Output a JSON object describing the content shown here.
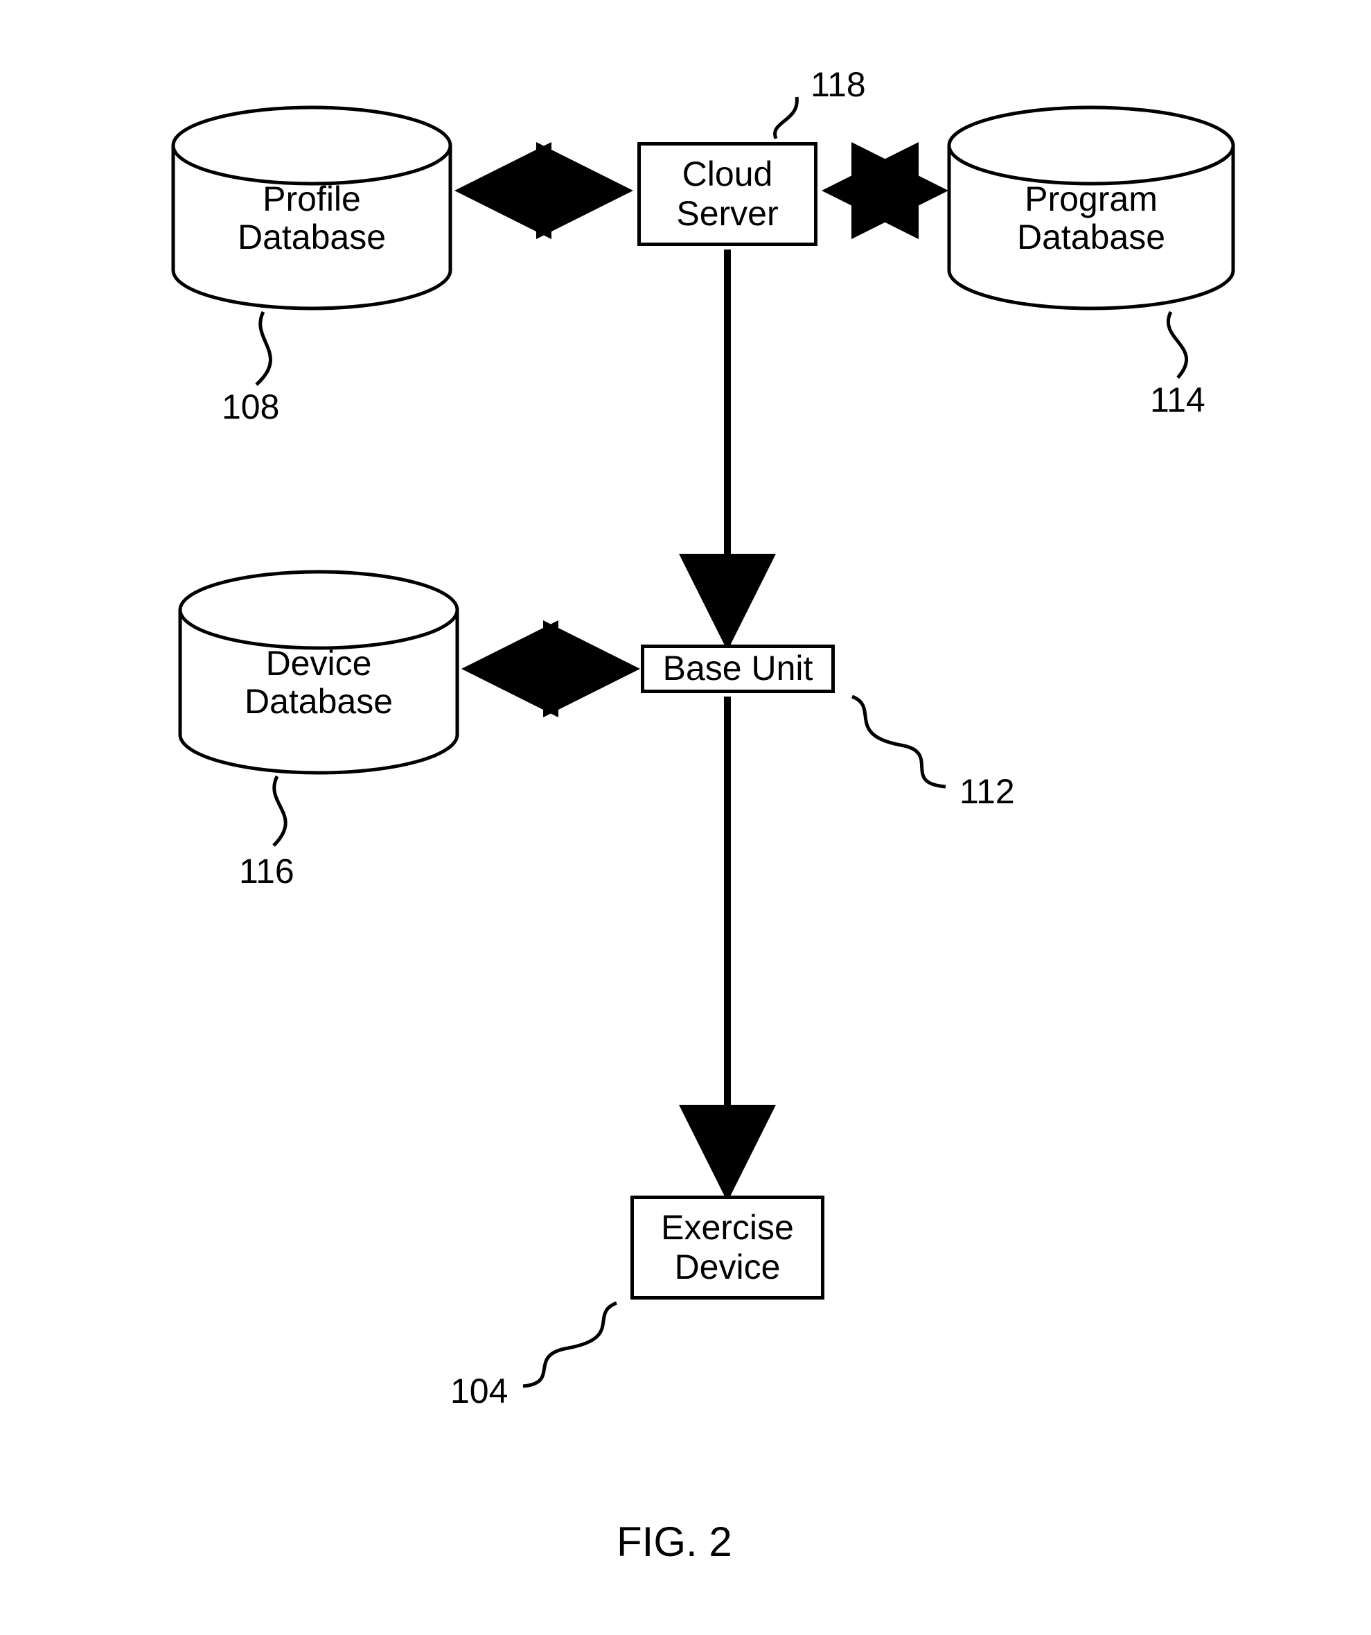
{
  "figure_caption": "FIG. 2",
  "nodes": {
    "cloud_server": {
      "label": "Cloud\nServer",
      "ref": "118"
    },
    "profile_db": {
      "label": "Profile\nDatabase",
      "ref": "108"
    },
    "program_db": {
      "label": "Program\nDatabase",
      "ref": "114"
    },
    "base_unit": {
      "label": "Base Unit",
      "ref": "112"
    },
    "device_db": {
      "label": "Device\nDatabase",
      "ref": "116"
    },
    "exercise_dev": {
      "label": "Exercise\nDevice",
      "ref": "104"
    }
  },
  "edges": [
    {
      "from": "profile_db",
      "to": "cloud_server",
      "dir": "both"
    },
    {
      "from": "program_db",
      "to": "cloud_server",
      "dir": "both"
    },
    {
      "from": "cloud_server",
      "to": "base_unit",
      "dir": "one"
    },
    {
      "from": "device_db",
      "to": "base_unit",
      "dir": "both"
    },
    {
      "from": "base_unit",
      "to": "exercise_dev",
      "dir": "one"
    }
  ]
}
